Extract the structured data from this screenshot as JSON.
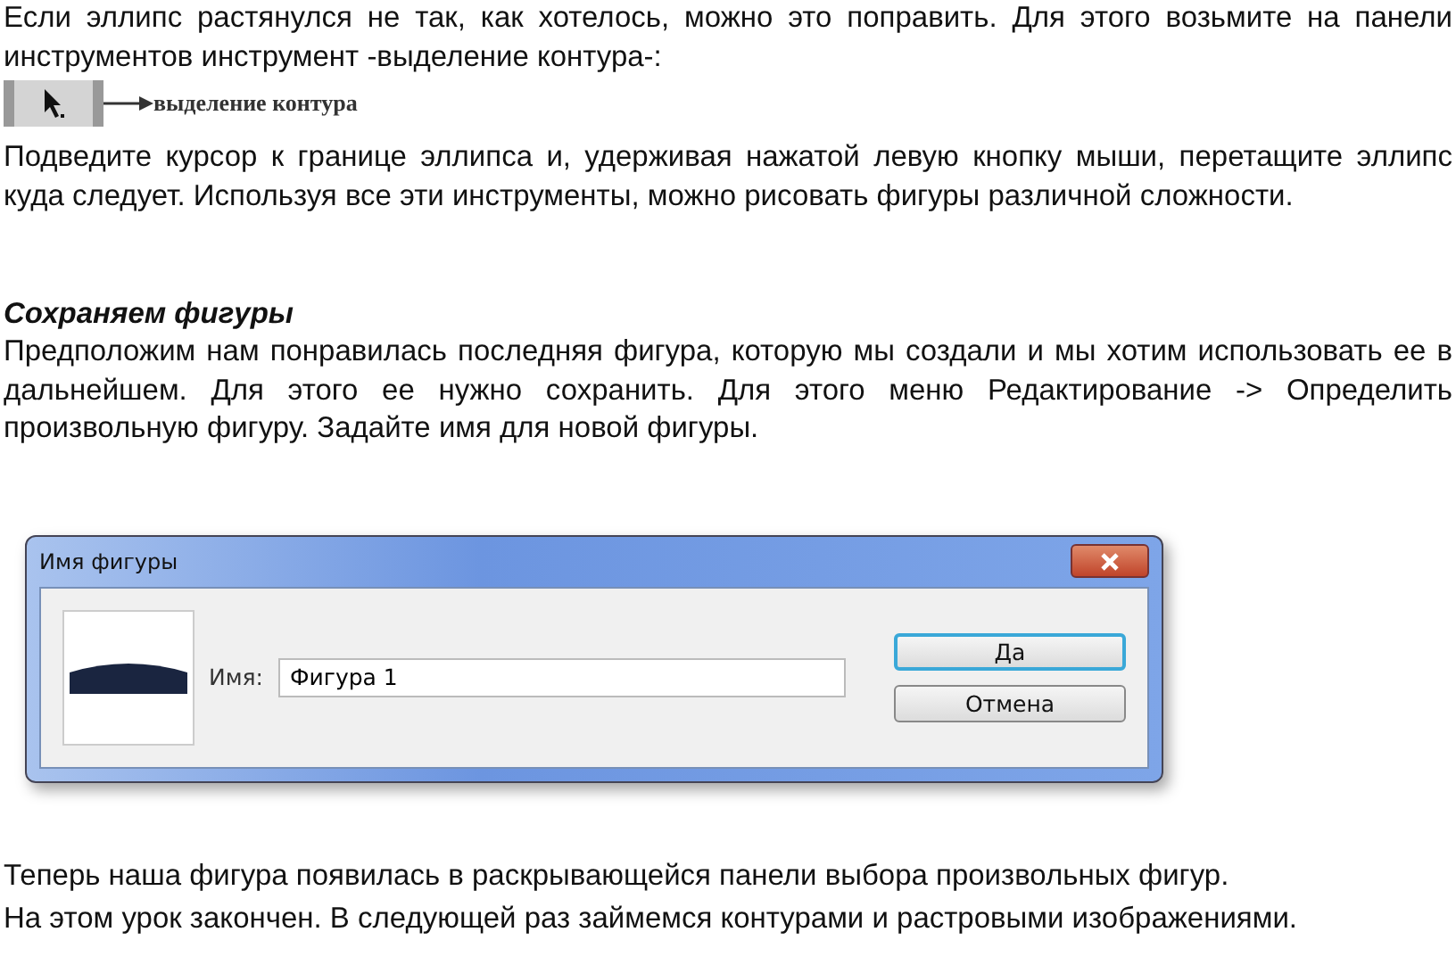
{
  "paragraphs_top": [
    "Если эллипс растянулся не так, как хотелось, можно это поправить. Для этого возьмите на панели инструментов инструмент -выделение контура-:"
  ],
  "tool_strip": {
    "label": "выделение контура"
  },
  "paragraphs_middle": [
    "Подведите курсор к границе эллипса и, удерживая нажатой левую кнопку мыши, перетащите эллипс куда следует. Используя все эти инструменты, можно рисовать фигуры различной сложности."
  ],
  "heading": "Сохраняем фигуры",
  "paragraphs_after_heading": [
    "Предположим нам понравилась последняя фигура, которую мы создали и мы хотим использовать ее в дальнейшем. Для этого ее нужно сохранить. Для этого меню Редактирование -> Определить произвольную фигуру. Задайте имя для новой фигуры."
  ],
  "dialog": {
    "title": "Имя фигуры",
    "field_label": "Имя:",
    "field_value": "Фигура 1",
    "buttons": [
      {
        "label": "Да",
        "default": true
      },
      {
        "label": "Отмена",
        "default": false
      }
    ]
  },
  "paragraphs_bottom": [
    "Теперь наша фигура появилась в раскрывающейся панели выбора произвольных фигур.",
    "На этом урок закончен. В следующей раз займемся контурами и растровыми изображениями."
  ]
}
